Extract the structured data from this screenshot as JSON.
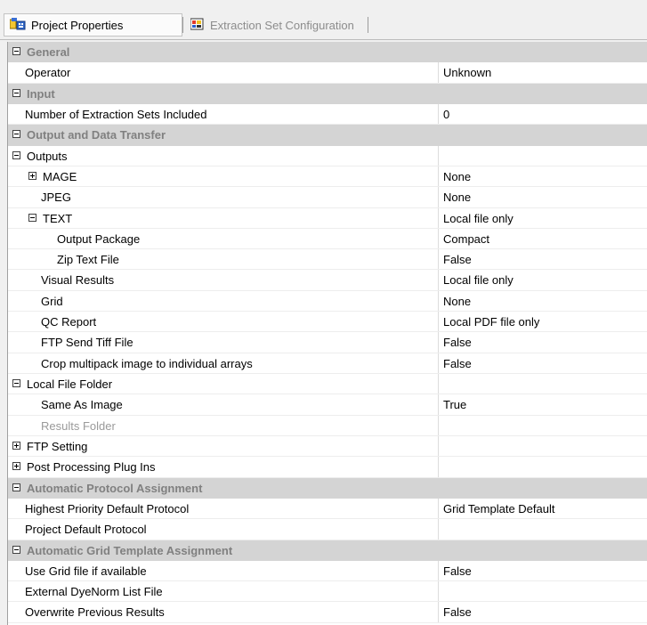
{
  "tabs": {
    "project_properties": "Project Properties",
    "extraction_set_configuration": "Extraction Set Configuration"
  },
  "rows": [
    {
      "type": "category",
      "label": "General",
      "expanded": true
    },
    {
      "type": "prop",
      "level": 0,
      "label": "Operator",
      "value": "Unknown"
    },
    {
      "type": "category",
      "label": "Input",
      "expanded": true
    },
    {
      "type": "prop",
      "level": 0,
      "label": "Number of Extraction Sets Included",
      "value": "0"
    },
    {
      "type": "category",
      "label": "Output and Data Transfer",
      "expanded": true
    },
    {
      "type": "group",
      "level": 0,
      "label": "Outputs",
      "value": "",
      "expander": "minus"
    },
    {
      "type": "group",
      "level": 1,
      "label": "MAGE",
      "value": "None",
      "expander": "plus"
    },
    {
      "type": "prop",
      "level": 1,
      "label": "JPEG",
      "value": "None"
    },
    {
      "type": "group",
      "level": 1,
      "label": "TEXT",
      "value": "Local file only",
      "expander": "minus"
    },
    {
      "type": "prop",
      "level": 2,
      "label": "Output Package",
      "value": "Compact"
    },
    {
      "type": "prop",
      "level": 2,
      "label": "Zip Text File",
      "value": "False"
    },
    {
      "type": "prop",
      "level": 1,
      "label": "Visual Results",
      "value": "Local file only"
    },
    {
      "type": "prop",
      "level": 1,
      "label": "Grid",
      "value": "None"
    },
    {
      "type": "prop",
      "level": 1,
      "label": "QC Report",
      "value": "Local PDF file only"
    },
    {
      "type": "prop",
      "level": 1,
      "label": "FTP Send Tiff File",
      "value": "False"
    },
    {
      "type": "prop",
      "level": 1,
      "label": "Crop multipack image to individual arrays",
      "value": "False"
    },
    {
      "type": "group",
      "level": 0,
      "label": "Local File Folder",
      "value": "",
      "expander": "minus"
    },
    {
      "type": "prop",
      "level": 1,
      "label": "Same As Image",
      "value": "True"
    },
    {
      "type": "prop",
      "level": 1,
      "label": "Results Folder",
      "value": "",
      "dim": true
    },
    {
      "type": "group",
      "level": 0,
      "label": "FTP Setting",
      "value": "",
      "expander": "plus"
    },
    {
      "type": "group",
      "level": 0,
      "label": "Post Processing Plug Ins",
      "value": "",
      "expander": "plus"
    },
    {
      "type": "category",
      "label": "Automatic Protocol Assignment",
      "expanded": true
    },
    {
      "type": "prop",
      "level": 0,
      "label": "Highest Priority Default Protocol",
      "value": "Grid Template Default"
    },
    {
      "type": "prop",
      "level": 0,
      "label": "Project Default Protocol",
      "value": ""
    },
    {
      "type": "category",
      "label": "Automatic Grid Template Assignment",
      "expanded": true
    },
    {
      "type": "prop",
      "level": 0,
      "label": "Use Grid file if available",
      "value": "False"
    },
    {
      "type": "prop",
      "level": 0,
      "label": "External DyeNorm List File",
      "value": ""
    },
    {
      "type": "prop",
      "level": 0,
      "label": "Overwrite Previous Results",
      "value": "False"
    }
  ]
}
